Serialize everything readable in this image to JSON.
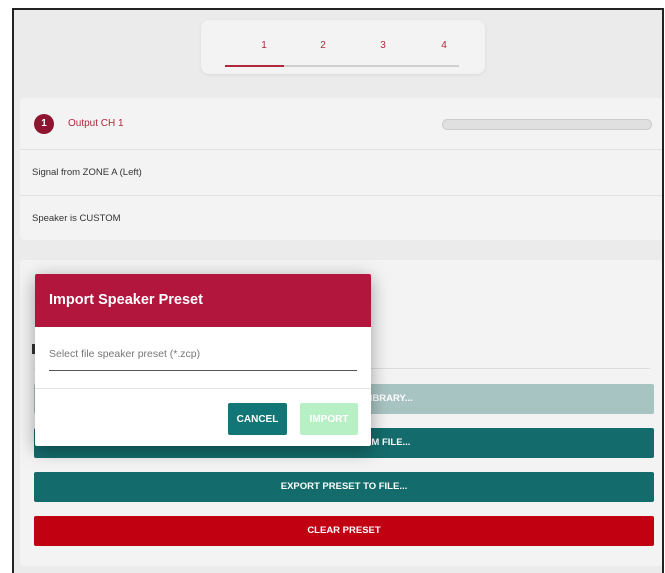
{
  "tabs": {
    "items": [
      {
        "label": "1"
      },
      {
        "label": "2"
      },
      {
        "label": "3"
      },
      {
        "label": "4"
      }
    ],
    "active": "1",
    "accent": "#b0283c"
  },
  "output": {
    "channel_number": "1",
    "title": "Output CH 1",
    "signal": "Signal from ZONE A (Left)",
    "speaker": "Speaker is CUSTOM",
    "badge_color": "#8e1530"
  },
  "preset": {
    "library_button_visible": "LIBRARY...",
    "import_file_button_visible": "OM FILE...",
    "export_button": "EXPORT PRESET TO FILE...",
    "clear_button": "CLEAR PRESET",
    "colors": {
      "teal": "#146b6b",
      "teal_disabled": "#a8c4c2",
      "red": "#c10012"
    }
  },
  "modal": {
    "title": "Import Speaker Preset",
    "input_placeholder": "Select file speaker preset (*.zcp)",
    "cancel_label": "CANCEL",
    "import_label": "IMPORT",
    "header_color": "#b3163c"
  }
}
